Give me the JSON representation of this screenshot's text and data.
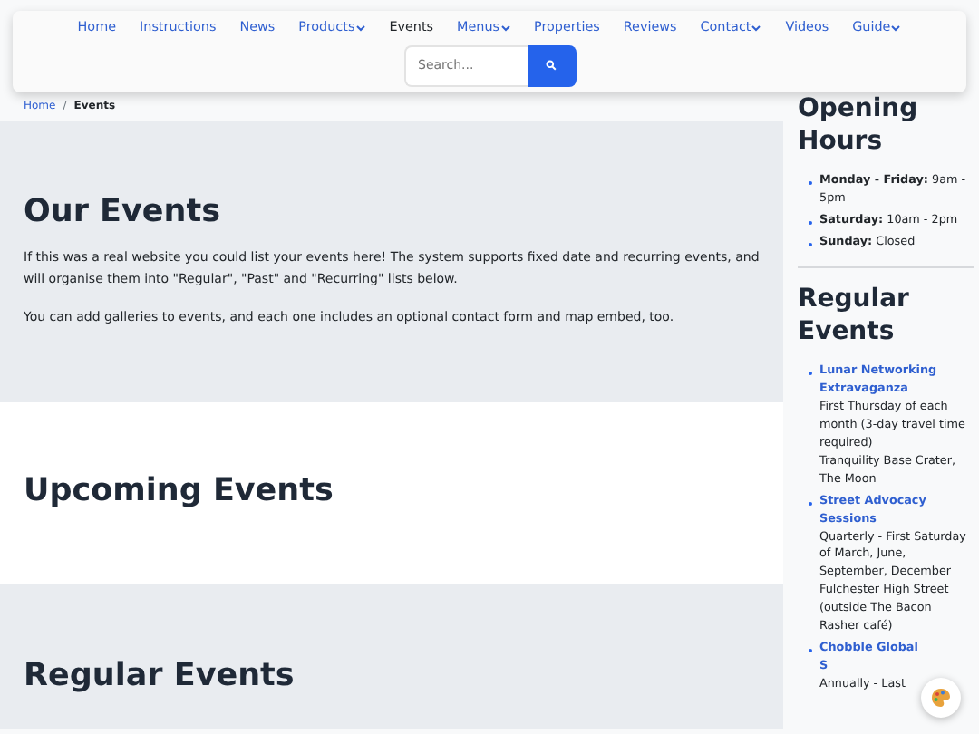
{
  "nav": {
    "items": [
      {
        "label": "Home",
        "selected": false,
        "dropdown": false
      },
      {
        "label": "Instructions",
        "selected": false,
        "dropdown": false
      },
      {
        "label": "News",
        "selected": false,
        "dropdown": false
      },
      {
        "label": "Products",
        "selected": false,
        "dropdown": true
      },
      {
        "label": "Events",
        "selected": true,
        "dropdown": false
      },
      {
        "label": "Menus",
        "selected": false,
        "dropdown": true
      },
      {
        "label": "Properties",
        "selected": false,
        "dropdown": false
      },
      {
        "label": "Reviews",
        "selected": false,
        "dropdown": false
      },
      {
        "label": "Contact",
        "selected": false,
        "dropdown": true
      },
      {
        "label": "Videos",
        "selected": false,
        "dropdown": false
      },
      {
        "label": "Guide",
        "selected": false,
        "dropdown": true
      }
    ],
    "search": {
      "placeholder": "Search..."
    }
  },
  "breadcrumb": {
    "separator": "/",
    "items": [
      {
        "label": "Home",
        "selected": false
      },
      {
        "label": "Events",
        "selected": true
      }
    ]
  },
  "sections": [
    {
      "heading": "Our Events",
      "shaded": true,
      "paragraphs": [
        "If this was a real website you could list your events here! The system supports fixed date and recurring events, and will organise them into \"Regular\", \"Past\" and \"Recurring\" lists below.",
        "You can add galleries to events, and each one includes an optional contact form and map embed, too."
      ]
    },
    {
      "heading": "Upcoming Events",
      "shaded": false
    },
    {
      "heading": "Regular Events",
      "shaded": true
    }
  ],
  "sidebar": {
    "hours_title": "Opening Hours",
    "hours": [
      {
        "day": "Monday - Friday:",
        "time": "9am - 5pm"
      },
      {
        "day": "Saturday:",
        "time": "10am - 2pm"
      },
      {
        "day": "Sunday:",
        "time": "Closed"
      }
    ],
    "events_title": "Regular Events",
    "events": [
      {
        "title": "Lunar Networking Extravaganza",
        "lines": [
          "First Thursday of each month (3-day travel time required)",
          "Tranquility Base Crater, The Moon"
        ]
      },
      {
        "title": "Street Advocacy Sessions",
        "lines": [
          "Quarterly - First Saturday of March, June, September, December",
          "Fulchester High Street (outside The Bacon Rasher café)"
        ]
      },
      {
        "title": "Chobble Global S",
        "lines": [
          "Annually - Last"
        ]
      }
    ]
  }
}
